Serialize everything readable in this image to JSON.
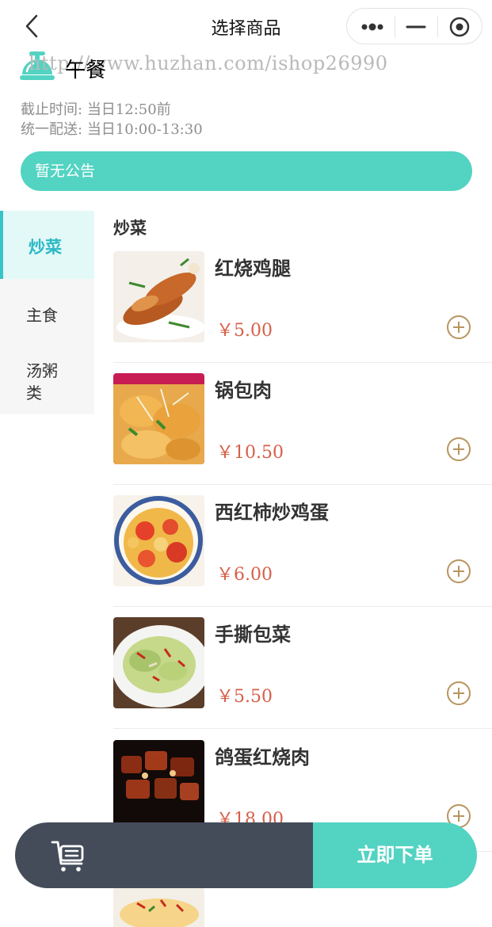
{
  "nav": {
    "title": "选择商品"
  },
  "watermark": "http://www.huzhan.com/ishop26990",
  "meal": {
    "title": "午餐",
    "deadline_label": "截止时间:",
    "deadline_value": "当日12:50前",
    "delivery_label": "统一配送:",
    "delivery_value": "当日10:00-13:30"
  },
  "notice": "暂无公告",
  "categories": [
    {
      "label": "炒菜",
      "active": true
    },
    {
      "label": "主食",
      "active": false
    },
    {
      "label": "汤粥类",
      "active": false
    }
  ],
  "section_title": "炒菜",
  "products": [
    {
      "name": "红烧鸡腿",
      "price": "￥5.00",
      "image": "braised-chicken-leg"
    },
    {
      "name": "锅包肉",
      "price": "￥10.50",
      "image": "guobaorou"
    },
    {
      "name": "西红柿炒鸡蛋",
      "price": "￥6.00",
      "image": "tomato-egg"
    },
    {
      "name": "手撕包菜",
      "price": "￥5.50",
      "image": "shredded-cabbage"
    },
    {
      "name": "鸽蛋红烧肉",
      "price": "￥18.00",
      "image": "braised-pork"
    }
  ],
  "cart": {
    "order_label": "立即下单"
  },
  "colors": {
    "accent": "#53d3c2",
    "cart_dark": "#444c5a",
    "price": "#d6604a",
    "add_icon": "#b8955e",
    "active_cat": "#2bb9c6"
  }
}
